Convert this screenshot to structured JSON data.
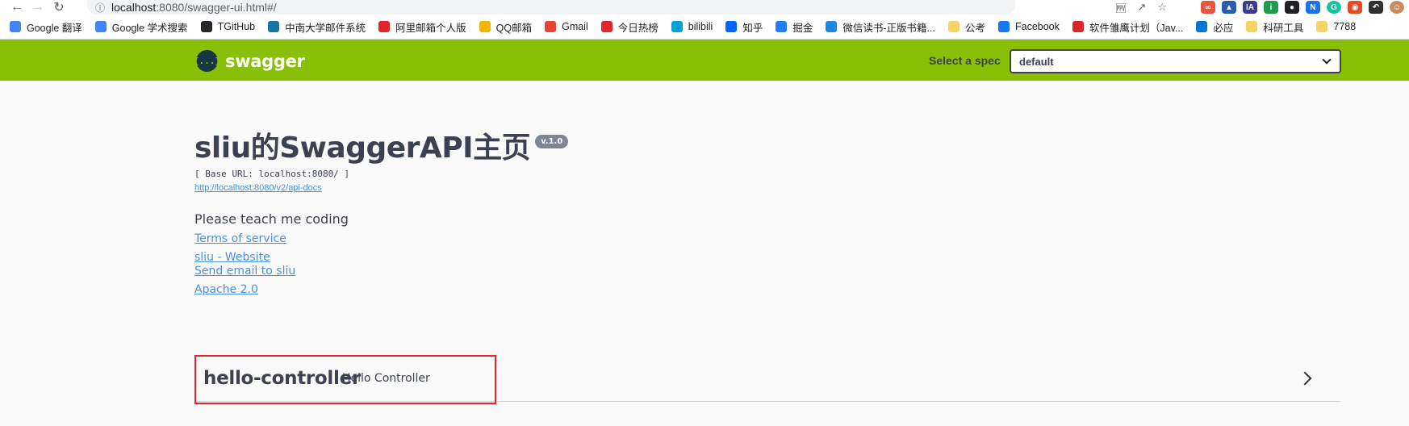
{
  "browser": {
    "url_host": "localhost",
    "url_path": ":8080/swagger-ui.html#/",
    "bookmarks": [
      {
        "label": "Google 翻译",
        "icon": "google-translate-icon",
        "color": "#4285f4"
      },
      {
        "label": "Google 学术搜索",
        "icon": "google-scholar-icon",
        "color": "#4285f4"
      },
      {
        "label": "TGitHub",
        "icon": "github-icon",
        "color": "#24292e"
      },
      {
        "label": "中南大学邮件系统",
        "icon": "csu-mail-icon",
        "color": "#1a73a8"
      },
      {
        "label": "阿里邮箱个人版",
        "icon": "ali-mail-icon",
        "color": "#e0262a"
      },
      {
        "label": "QQ邮箱",
        "icon": "qq-mail-icon",
        "color": "#f4b400"
      },
      {
        "label": "Gmail",
        "icon": "gmail-icon",
        "color": "#ea4335"
      },
      {
        "label": "今日热榜",
        "icon": "rebang-icon",
        "color": "#e0262a"
      },
      {
        "label": "bilibili",
        "icon": "bilibili-icon",
        "color": "#00a1d6"
      },
      {
        "label": "知乎",
        "icon": "zhihu-icon",
        "color": "#0066ff"
      },
      {
        "label": "掘金",
        "icon": "juejin-icon",
        "color": "#1e80ff"
      },
      {
        "label": "微信读书-正版书籍...",
        "icon": "weread-icon",
        "color": "#1e88e5"
      },
      {
        "label": "公考",
        "icon": "folder-icon",
        "color": "#f6d365"
      },
      {
        "label": "Facebook",
        "icon": "facebook-icon",
        "color": "#1877f2"
      },
      {
        "label": "软件雏鹰计划（Jav...",
        "icon": "software-plan-icon",
        "color": "#d62828"
      },
      {
        "label": "必应",
        "icon": "bing-icon",
        "color": "#0078d4"
      },
      {
        "label": "科研工具",
        "icon": "folder-icon",
        "color": "#f6d365"
      },
      {
        "label": "7788",
        "icon": "folder-icon",
        "color": "#f6d365"
      }
    ]
  },
  "swagger": {
    "logo_text": "swagger",
    "logo_glyph": "{...}",
    "spec_label": "Select a spec",
    "spec_value": "default",
    "accent_color": "#89bf04"
  },
  "info": {
    "title": "sliu的SwaggerAPI主页",
    "version": "v.1.0",
    "base_url": "[ Base URL: localhost:8080/ ]",
    "docs_link": "http://localhost:8080/v2/api-docs",
    "description": "Please teach me coding",
    "terms": "Terms of service",
    "website": "sliu - Website",
    "email": "Send email to sliu",
    "license": "Apache 2.0"
  },
  "tags": [
    {
      "name": "hello-controller",
      "description": "Hello Controller"
    }
  ]
}
